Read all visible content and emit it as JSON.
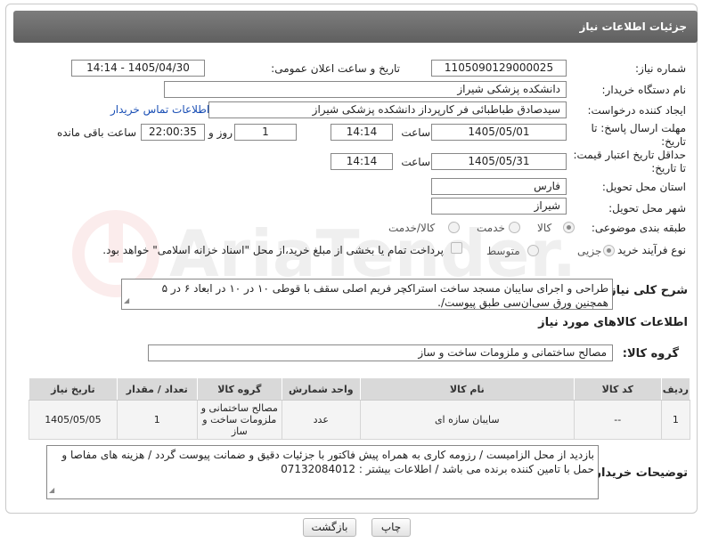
{
  "header": {
    "title": "جزئیات اطلاعات نیاز"
  },
  "fields": {
    "need_number_label": "شماره نیاز:",
    "need_number": "1105090129000025",
    "announce_label": "تاریخ و ساعت اعلان عمومی:",
    "announce_value": "1405/04/30 - 14:14",
    "buyer_org_label": "نام دستگاه خریدار:",
    "buyer_org": "دانشکده پزشکی شیراز",
    "requester_label": "ایجاد کننده درخواست:",
    "requester": "سیدصادق طباطبائی فر کارپرداز دانشکده پزشکی شیراز",
    "buyer_contact_link": "اطلاعات تماس خریدار",
    "reply_deadline_label": "مهلت ارسال پاسخ: تا تاریخ:",
    "reply_date": "1405/05/01",
    "time_label": "ساعت",
    "reply_time": "14:14",
    "day_value": "1",
    "day_and_label": "روز و",
    "remaining_time": "22:00:35",
    "remaining_label": "ساعت باقی مانده",
    "price_validity_label": "حداقل تاریخ اعتبار قیمت: تا تاریخ:",
    "validity_date": "1405/05/31",
    "validity_time": "14:14",
    "province_label": "استان محل تحویل:",
    "province": "فارس",
    "city_label": "شهر محل تحویل:",
    "city": "شیراز",
    "category_label": "طبقه بندی موضوعی:",
    "category_options": [
      "کالا",
      "خدمت",
      "کالا/خدمت"
    ],
    "process_label": "نوع فرآیند خرید :",
    "process_options": [
      "جزیی",
      "متوسط"
    ],
    "payment_note": "پرداخت تمام یا بخشی از مبلغ خرید،از محل \"اسناد خزانه اسلامی\" خواهد بود."
  },
  "description": {
    "label": "شرح کلی نیاز:",
    "text": "طراحی و اجرای سایبان مسجد ساخت استراکچر فریم اصلی سقف با قوطی ۱۰ در ۱۰ در ابعاد ۶ در ۵ همچنین ورق سی‌ان‌سی طبق پیوست/."
  },
  "goods_section": {
    "title": "اطلاعات کالاهای مورد نیاز",
    "group_label": "گروه کالا:",
    "group_value": "مصالح ساختمانی و ملزومات ساخت و ساز"
  },
  "table": {
    "headers": [
      "ردیف",
      "کد کالا",
      "نام کالا",
      "واحد شمارش",
      "گروه کالا",
      "تعداد / مقدار",
      "تاریخ نیاز"
    ],
    "rows": [
      [
        "1",
        "--",
        "سایبان سازه ای",
        "عدد",
        "مصالح ساختمانی و ملزومات ساخت و ساز",
        "1",
        "1405/05/05"
      ]
    ]
  },
  "buyer_notes": {
    "label": "توضیحات خریدار:",
    "text": "بازدید از محل الزامیست / رزومه کاری به همراه پیش فاکتور با جزئیات دقیق و ضمانت پیوست گردد / هزینه های مفاصا و حمل با تامین کننده برنده می باشد / اطلاعات بیشتر : 07132084012"
  },
  "buttons": {
    "print": "چاپ",
    "back": "بازگشت"
  },
  "icons": {
    "watermark": "aria-tender-logo"
  }
}
